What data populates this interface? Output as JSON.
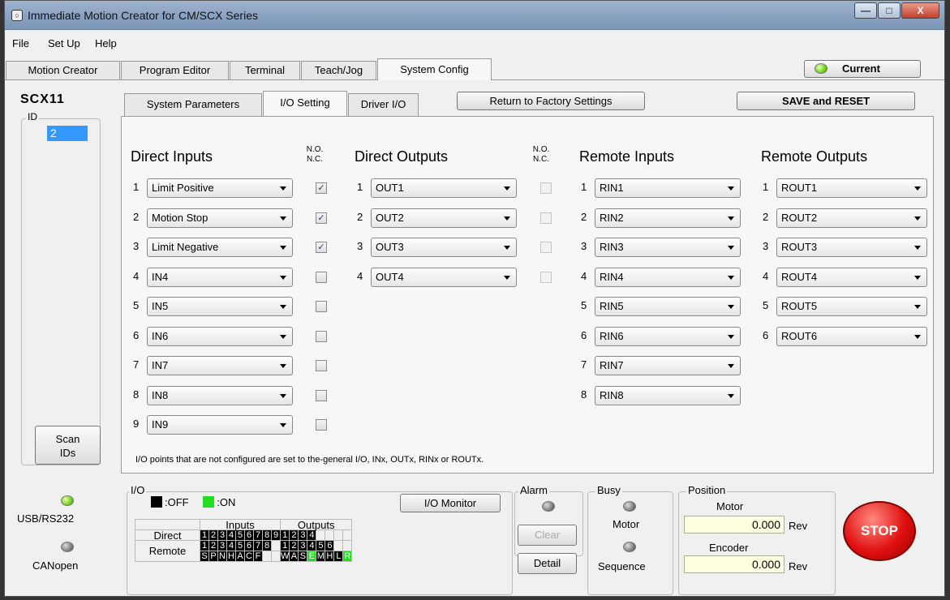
{
  "window": {
    "title": "Immediate Motion Creator for CM/SCX Series",
    "app_icon": "○",
    "min": "—",
    "max": "□",
    "close": "X"
  },
  "menu": [
    "File",
    "Set Up",
    "Help"
  ],
  "tabs": [
    "Motion Creator",
    "Program Editor",
    "Terminal",
    "Teach/Jog",
    "System Config"
  ],
  "active_tab": "System Config",
  "current_button": "Current",
  "model": "SCX11",
  "id_label": "ID",
  "id_value": "2",
  "scan_button": "Scan IDs",
  "sub_tabs": [
    "System Parameters",
    "I/O Setting",
    "Driver I/O"
  ],
  "active_sub_tab": "I/O Setting",
  "factory_button": "Return to Factory Settings",
  "save_button": "SAVE and RESET",
  "nonc_label": {
    "no": "N.O.",
    "nc": "N.C."
  },
  "direct_inputs": {
    "title": "Direct Inputs",
    "rows": [
      {
        "n": "1",
        "value": "Limit Positive",
        "checked": true
      },
      {
        "n": "2",
        "value": "Motion Stop",
        "checked": true
      },
      {
        "n": "3",
        "value": "Limit Negative",
        "checked": true
      },
      {
        "n": "4",
        "value": "IN4",
        "checked": false
      },
      {
        "n": "5",
        "value": "IN5",
        "checked": false
      },
      {
        "n": "6",
        "value": "IN6",
        "checked": false
      },
      {
        "n": "7",
        "value": "IN7",
        "checked": false
      },
      {
        "n": "8",
        "value": "IN8",
        "checked": false
      },
      {
        "n": "9",
        "value": "IN9",
        "checked": false
      }
    ]
  },
  "direct_outputs": {
    "title": "Direct Outputs",
    "rows": [
      {
        "n": "1",
        "value": "OUT1"
      },
      {
        "n": "2",
        "value": "OUT2"
      },
      {
        "n": "3",
        "value": "OUT3"
      },
      {
        "n": "4",
        "value": "OUT4"
      }
    ]
  },
  "remote_inputs": {
    "title": "Remote Inputs",
    "rows": [
      {
        "n": "1",
        "value": "RIN1"
      },
      {
        "n": "2",
        "value": "RIN2"
      },
      {
        "n": "3",
        "value": "RIN3"
      },
      {
        "n": "4",
        "value": "RIN4"
      },
      {
        "n": "5",
        "value": "RIN5"
      },
      {
        "n": "6",
        "value": "RIN6"
      },
      {
        "n": "7",
        "value": "RIN7"
      },
      {
        "n": "8",
        "value": "RIN8"
      }
    ]
  },
  "remote_outputs": {
    "title": "Remote Outputs",
    "rows": [
      {
        "n": "1",
        "value": "ROUT1"
      },
      {
        "n": "2",
        "value": "ROUT2"
      },
      {
        "n": "3",
        "value": "ROUT3"
      },
      {
        "n": "4",
        "value": "ROUT4"
      },
      {
        "n": "5",
        "value": "ROUT5"
      },
      {
        "n": "6",
        "value": "ROUT6"
      }
    ]
  },
  "note": "I/O points that are not configured are set to the-general I/O, INx, OUTx, RINx or ROUTx.",
  "status": {
    "usb": "USB/RS232",
    "canopen": "CANopen"
  },
  "io": {
    "label": "I/O",
    "legend_off": ":OFF",
    "legend_on": ":ON",
    "monitor_button": "I/O Monitor",
    "inputs_header": "Inputs",
    "outputs_header": "Outputs",
    "direct_label": "Direct",
    "remote_label": "Remote",
    "direct_inputs": [
      "1",
      "2",
      "3",
      "4",
      "5",
      "6",
      "7",
      "8",
      "9"
    ],
    "direct_outputs": [
      "1",
      "2",
      "3",
      "4",
      "",
      "",
      "",
      ""
    ],
    "remote_inputs_num": [
      "1",
      "2",
      "3",
      "4",
      "5",
      "6",
      "7",
      "8",
      ""
    ],
    "remote_outputs_num": [
      "1",
      "2",
      "3",
      "4",
      "5",
      "6",
      "",
      ""
    ],
    "remote_inputs_sig": [
      "S",
      "P",
      "N",
      "H",
      "A",
      "C",
      "F",
      "",
      ""
    ],
    "remote_outputs_sig": [
      "W",
      "A",
      "S",
      "E",
      "M",
      "H",
      "L",
      "R"
    ],
    "remote_outputs_sig_on": [
      false,
      false,
      false,
      true,
      false,
      false,
      false,
      true
    ]
  },
  "alarm": {
    "label": "Alarm",
    "clear": "Clear",
    "detail": "Detail"
  },
  "busy": {
    "label": "Busy",
    "motor": "Motor",
    "sequence": "Sequence"
  },
  "position": {
    "label": "Position",
    "motor_label": "Motor",
    "motor_value": "0.000",
    "encoder_label": "Encoder",
    "encoder_value": "0.000",
    "unit": "Rev"
  },
  "stop_button": "STOP",
  "colors": {
    "selection": "#3399ff",
    "on": "#22dd22",
    "off": "#000000",
    "stop": "#e01010"
  }
}
